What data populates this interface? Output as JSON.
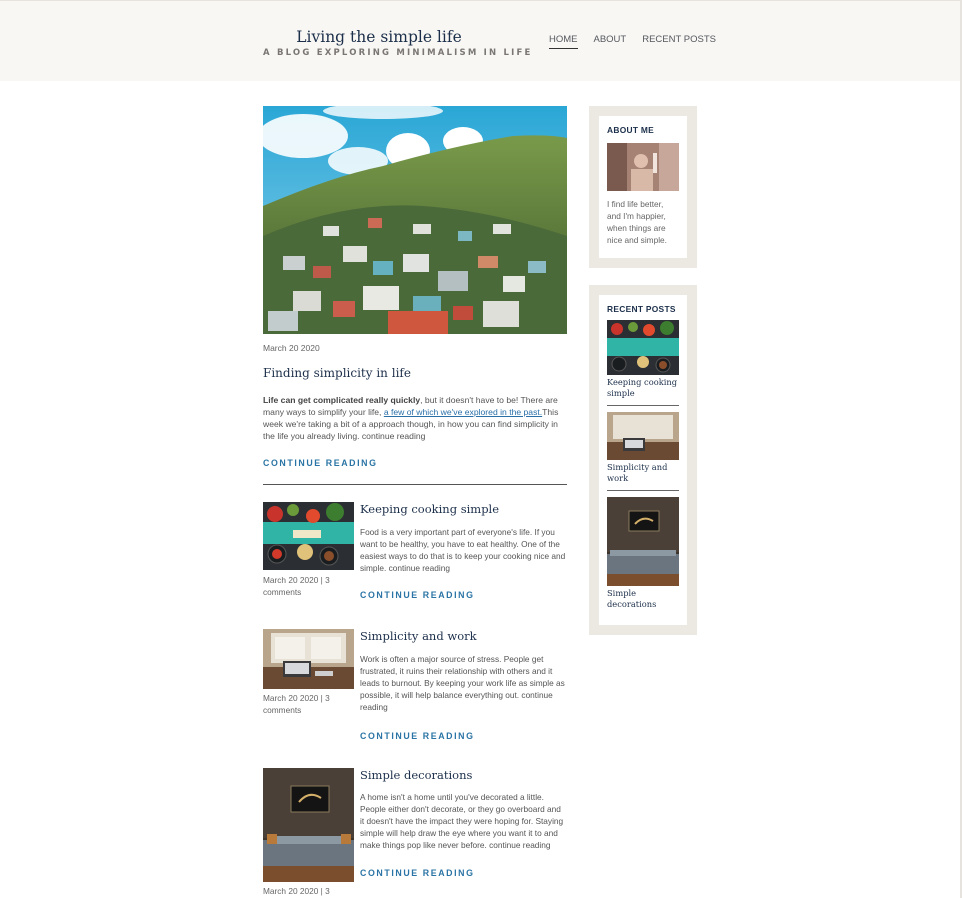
{
  "site": {
    "title": "Living the simple life",
    "tagline": "A BLOG EXPLORING MINIMALISM IN LIFE"
  },
  "nav": {
    "home": "HOME",
    "about": "ABOUT",
    "recent_posts": "RECENT POSTS"
  },
  "hero": {
    "date": "March 20 2020",
    "title": "Finding simplicity in life",
    "excerpt_bold": "Life can get complicated really quickly",
    "excerpt_part1": ", but it doesn't have to be! There are many ways to simplify your life, ",
    "excerpt_link": "a few of which we've explored in the past.",
    "excerpt_part2": "This week we're taking a bit of a approach though, in how you can find simplicity in the life you already living. continue reading",
    "cta": "CONTINUE READING"
  },
  "posts": [
    {
      "title": "Keeping cooking simple",
      "meta": "March 20 2020 | 3 comments",
      "excerpt": "Food is a very important part of everyone's life. If you want to be healthy, you have to eat healthy. One of the easiest ways to do that is to keep your cooking nice and simple. continue reading",
      "cta": "CONTINUE READING"
    },
    {
      "title": "Simplicity and work",
      "meta": "March 20 2020 | 3 comments",
      "excerpt": "Work is often a major source of stress. People get frustrated, it ruins their relationship with others and it leads to burnout. By keeping your work life as simple as possible, it will help balance everything out. continue reading",
      "cta": "CONTINUE READING"
    },
    {
      "title": "Simple decorations",
      "meta": "March 20 2020 | 3",
      "excerpt": "A home isn't a home until you've decorated a little. People either don't decorate, or they go overboard and it doesn't have the impact they were hoping for. Staying simple will help draw the eye where you want it to and make things pop like never before. continue reading",
      "cta": "CONTINUE READING"
    }
  ],
  "sidebar": {
    "about_heading": "ABOUT ME",
    "about_text": "I find life better, and I'm happier, when things are nice and simple.",
    "recent_heading": "RECENT POSTS",
    "recent": [
      {
        "label": "Keeping cooking simple"
      },
      {
        "label": "Simplicity and work"
      },
      {
        "label": "Simple decorations"
      }
    ]
  },
  "colors": {
    "header_bg": "#f8f7f4",
    "title_navy": "#1c2f4a",
    "link_blue": "#2a74a5",
    "sidebar_bg": "#ece9e3"
  }
}
